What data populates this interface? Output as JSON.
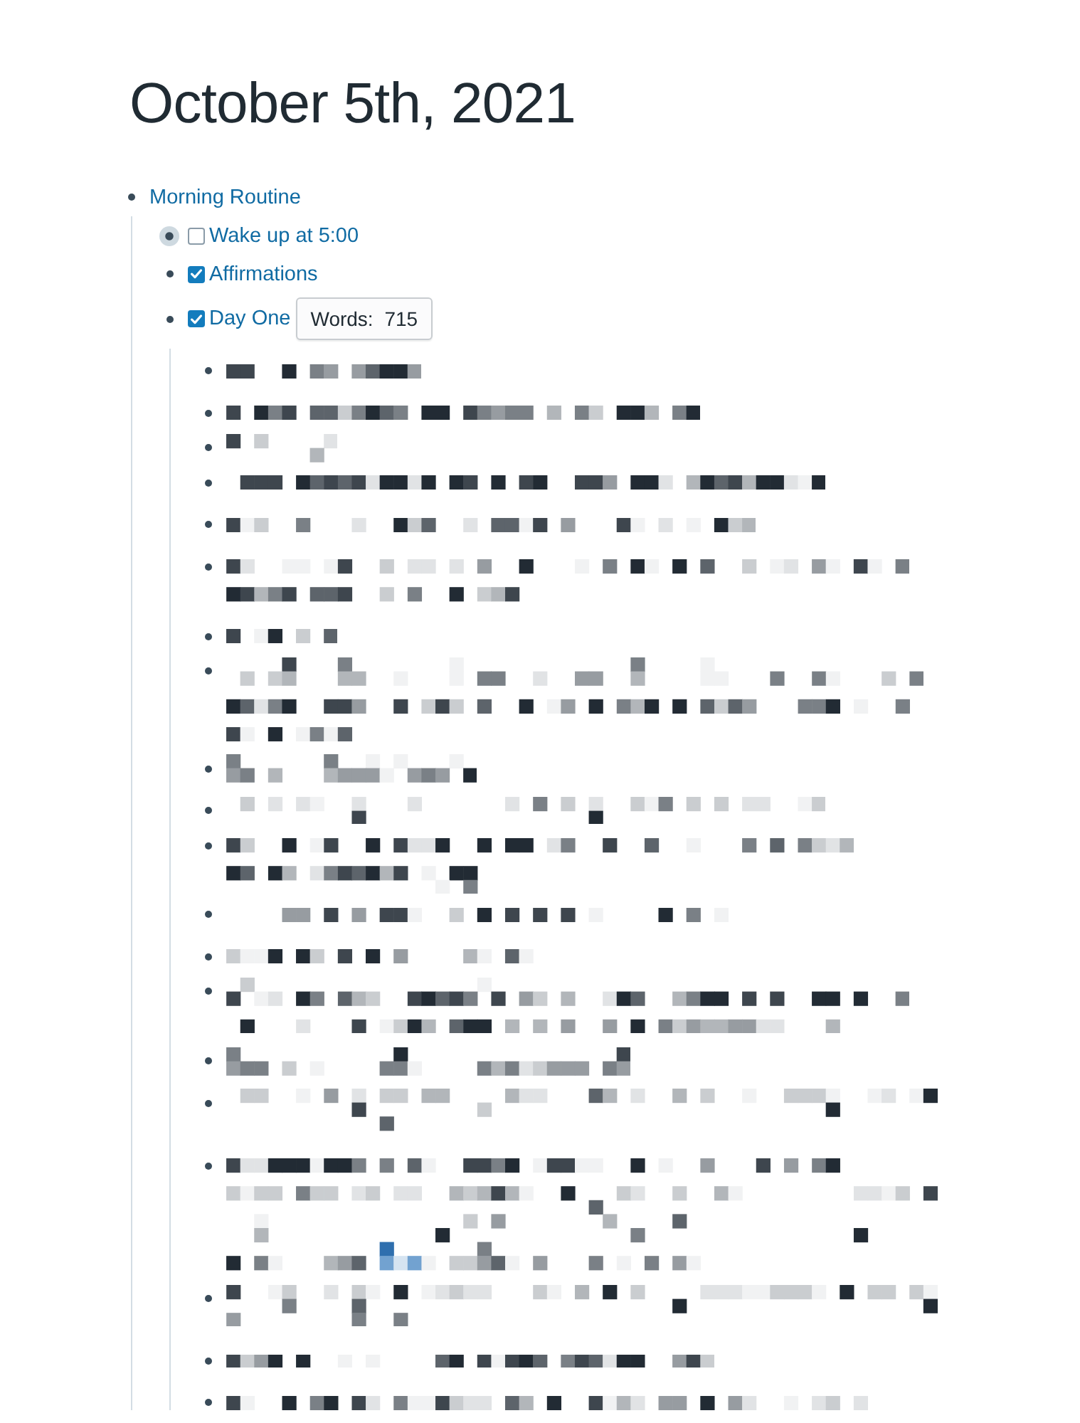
{
  "page_title": "October 5th, 2021",
  "blocks": [
    {
      "kind": "link",
      "text": "Morning Routine",
      "children": [
        {
          "kind": "todo",
          "text": "Wake up at 5:00",
          "checked": false,
          "collapsed": true
        },
        {
          "kind": "todo",
          "text": "Affirmations",
          "checked": true,
          "collapsed": false
        },
        {
          "kind": "todo",
          "text": "Day One",
          "checked": true,
          "collapsed": false,
          "word_count": "Words: 715",
          "children": [
            {
              "kind": "pixelated"
            },
            {
              "kind": "pixelated"
            },
            {
              "kind": "pixelated"
            },
            {
              "kind": "pixelated"
            },
            {
              "kind": "pixelated"
            },
            {
              "kind": "pixelated"
            },
            {
              "kind": "pixelated"
            },
            {
              "kind": "pixelated"
            },
            {
              "kind": "pixelated"
            },
            {
              "kind": "pixelated"
            },
            {
              "kind": "pixelated"
            },
            {
              "kind": "pixelated"
            },
            {
              "kind": "pixelated"
            },
            {
              "kind": "pixelated"
            },
            {
              "kind": "pixelated"
            },
            {
              "kind": "pixelated"
            },
            {
              "kind": "pixelated"
            },
            {
              "kind": "pixelated"
            },
            {
              "kind": "pixelated"
            },
            {
              "kind": "pixelated"
            }
          ]
        }
      ]
    }
  ]
}
